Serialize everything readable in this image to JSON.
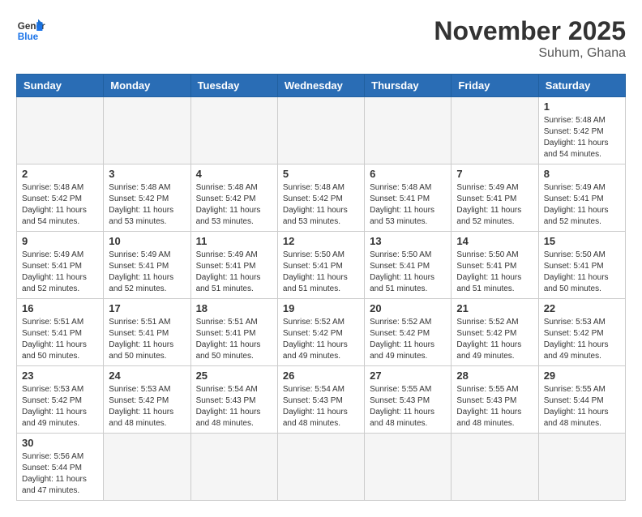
{
  "logo": {
    "line1": "General",
    "line2": "Blue"
  },
  "title": "November 2025",
  "subtitle": "Suhum, Ghana",
  "days_of_week": [
    "Sunday",
    "Monday",
    "Tuesday",
    "Wednesday",
    "Thursday",
    "Friday",
    "Saturday"
  ],
  "weeks": [
    [
      {
        "day": "",
        "info": ""
      },
      {
        "day": "",
        "info": ""
      },
      {
        "day": "",
        "info": ""
      },
      {
        "day": "",
        "info": ""
      },
      {
        "day": "",
        "info": ""
      },
      {
        "day": "",
        "info": ""
      },
      {
        "day": "1",
        "info": "Sunrise: 5:48 AM\nSunset: 5:42 PM\nDaylight: 11 hours\nand 54 minutes."
      }
    ],
    [
      {
        "day": "2",
        "info": "Sunrise: 5:48 AM\nSunset: 5:42 PM\nDaylight: 11 hours\nand 54 minutes."
      },
      {
        "day": "3",
        "info": "Sunrise: 5:48 AM\nSunset: 5:42 PM\nDaylight: 11 hours\nand 53 minutes."
      },
      {
        "day": "4",
        "info": "Sunrise: 5:48 AM\nSunset: 5:42 PM\nDaylight: 11 hours\nand 53 minutes."
      },
      {
        "day": "5",
        "info": "Sunrise: 5:48 AM\nSunset: 5:42 PM\nDaylight: 11 hours\nand 53 minutes."
      },
      {
        "day": "6",
        "info": "Sunrise: 5:48 AM\nSunset: 5:41 PM\nDaylight: 11 hours\nand 53 minutes."
      },
      {
        "day": "7",
        "info": "Sunrise: 5:49 AM\nSunset: 5:41 PM\nDaylight: 11 hours\nand 52 minutes."
      },
      {
        "day": "8",
        "info": "Sunrise: 5:49 AM\nSunset: 5:41 PM\nDaylight: 11 hours\nand 52 minutes."
      }
    ],
    [
      {
        "day": "9",
        "info": "Sunrise: 5:49 AM\nSunset: 5:41 PM\nDaylight: 11 hours\nand 52 minutes."
      },
      {
        "day": "10",
        "info": "Sunrise: 5:49 AM\nSunset: 5:41 PM\nDaylight: 11 hours\nand 52 minutes."
      },
      {
        "day": "11",
        "info": "Sunrise: 5:49 AM\nSunset: 5:41 PM\nDaylight: 11 hours\nand 51 minutes."
      },
      {
        "day": "12",
        "info": "Sunrise: 5:50 AM\nSunset: 5:41 PM\nDaylight: 11 hours\nand 51 minutes."
      },
      {
        "day": "13",
        "info": "Sunrise: 5:50 AM\nSunset: 5:41 PM\nDaylight: 11 hours\nand 51 minutes."
      },
      {
        "day": "14",
        "info": "Sunrise: 5:50 AM\nSunset: 5:41 PM\nDaylight: 11 hours\nand 51 minutes."
      },
      {
        "day": "15",
        "info": "Sunrise: 5:50 AM\nSunset: 5:41 PM\nDaylight: 11 hours\nand 50 minutes."
      }
    ],
    [
      {
        "day": "16",
        "info": "Sunrise: 5:51 AM\nSunset: 5:41 PM\nDaylight: 11 hours\nand 50 minutes."
      },
      {
        "day": "17",
        "info": "Sunrise: 5:51 AM\nSunset: 5:41 PM\nDaylight: 11 hours\nand 50 minutes."
      },
      {
        "day": "18",
        "info": "Sunrise: 5:51 AM\nSunset: 5:41 PM\nDaylight: 11 hours\nand 50 minutes."
      },
      {
        "day": "19",
        "info": "Sunrise: 5:52 AM\nSunset: 5:42 PM\nDaylight: 11 hours\nand 49 minutes."
      },
      {
        "day": "20",
        "info": "Sunrise: 5:52 AM\nSunset: 5:42 PM\nDaylight: 11 hours\nand 49 minutes."
      },
      {
        "day": "21",
        "info": "Sunrise: 5:52 AM\nSunset: 5:42 PM\nDaylight: 11 hours\nand 49 minutes."
      },
      {
        "day": "22",
        "info": "Sunrise: 5:53 AM\nSunset: 5:42 PM\nDaylight: 11 hours\nand 49 minutes."
      }
    ],
    [
      {
        "day": "23",
        "info": "Sunrise: 5:53 AM\nSunset: 5:42 PM\nDaylight: 11 hours\nand 49 minutes."
      },
      {
        "day": "24",
        "info": "Sunrise: 5:53 AM\nSunset: 5:42 PM\nDaylight: 11 hours\nand 48 minutes."
      },
      {
        "day": "25",
        "info": "Sunrise: 5:54 AM\nSunset: 5:43 PM\nDaylight: 11 hours\nand 48 minutes."
      },
      {
        "day": "26",
        "info": "Sunrise: 5:54 AM\nSunset: 5:43 PM\nDaylight: 11 hours\nand 48 minutes."
      },
      {
        "day": "27",
        "info": "Sunrise: 5:55 AM\nSunset: 5:43 PM\nDaylight: 11 hours\nand 48 minutes."
      },
      {
        "day": "28",
        "info": "Sunrise: 5:55 AM\nSunset: 5:43 PM\nDaylight: 11 hours\nand 48 minutes."
      },
      {
        "day": "29",
        "info": "Sunrise: 5:55 AM\nSunset: 5:44 PM\nDaylight: 11 hours\nand 48 minutes."
      }
    ],
    [
      {
        "day": "30",
        "info": "Sunrise: 5:56 AM\nSunset: 5:44 PM\nDaylight: 11 hours\nand 47 minutes."
      },
      {
        "day": "",
        "info": ""
      },
      {
        "day": "",
        "info": ""
      },
      {
        "day": "",
        "info": ""
      },
      {
        "day": "",
        "info": ""
      },
      {
        "day": "",
        "info": ""
      },
      {
        "day": "",
        "info": ""
      }
    ]
  ]
}
